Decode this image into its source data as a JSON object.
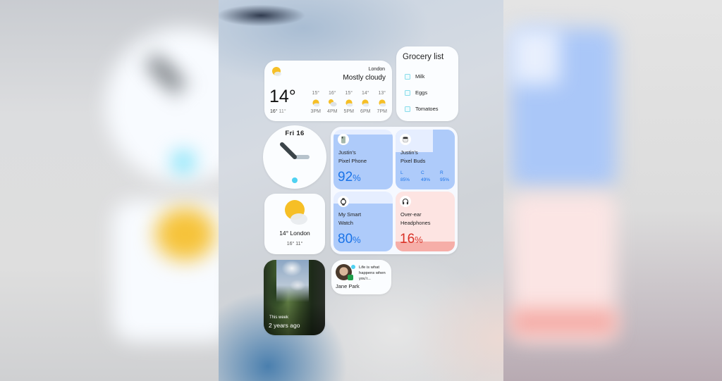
{
  "weather_wide": {
    "location": "London",
    "condition": "Mostly cloudy",
    "current_temp": "14°",
    "high": "16°",
    "low": "11°",
    "hourly": [
      {
        "time": "3PM",
        "temp": "15°",
        "icon": "partly-sunny-icon"
      },
      {
        "time": "4PM",
        "temp": "16°",
        "icon": "sun-behind-cloud-icon"
      },
      {
        "time": "5PM",
        "temp": "15°",
        "icon": "partly-sunny-icon"
      },
      {
        "time": "6PM",
        "temp": "14°",
        "icon": "partly-sunny-icon"
      },
      {
        "time": "7PM",
        "temp": "13°",
        "icon": "partly-sunny-icon"
      }
    ]
  },
  "grocery": {
    "title": "Grocery list",
    "items": [
      {
        "label": "Milk",
        "checked": false
      },
      {
        "label": "Eggs",
        "checked": false
      },
      {
        "label": "Tomatoes",
        "checked": false
      }
    ]
  },
  "clock": {
    "date": "Fri 16",
    "time": "10:15"
  },
  "batteries": {
    "devices": [
      {
        "name_line1": "Justin's",
        "name_line2": "Pixel Phone",
        "percent": 92,
        "percent_label": "92",
        "icon": "phone-icon",
        "color": "#1a73e8"
      },
      {
        "name_line1": "Justin's",
        "name_line2": "Pixel Buds",
        "icon": "earbuds-case-icon",
        "color": "#1a73e8",
        "buds": [
          {
            "side": "L",
            "percent": 85,
            "label": "85%"
          },
          {
            "side": "C",
            "percent": 49,
            "label": "49%"
          },
          {
            "side": "R",
            "percent": 95,
            "label": "95%"
          }
        ]
      },
      {
        "name_line1": "My Smart",
        "name_line2": "Watch",
        "percent": 80,
        "percent_label": "80",
        "icon": "watch-icon",
        "color": "#1a73e8"
      },
      {
        "name_line1": "Over-ear",
        "name_line2": "Headphones",
        "percent": 16,
        "percent_label": "16",
        "icon": "headphones-icon",
        "color": "#d93025"
      }
    ],
    "percent_sign": "%"
  },
  "weather_small": {
    "line1": "14° London",
    "line2": "16° 11°"
  },
  "photo": {
    "caption_small": "This week",
    "caption_large": "2 years ago"
  },
  "conversation": {
    "contact": "Jane Park",
    "message": "Life is what happens when you'r..."
  },
  "colors": {
    "accent_blue": "#1a73e8",
    "battery_fill_blue": "#aecbfa",
    "battery_red": "#d93025",
    "online_cyan": "#4fd2f2"
  }
}
